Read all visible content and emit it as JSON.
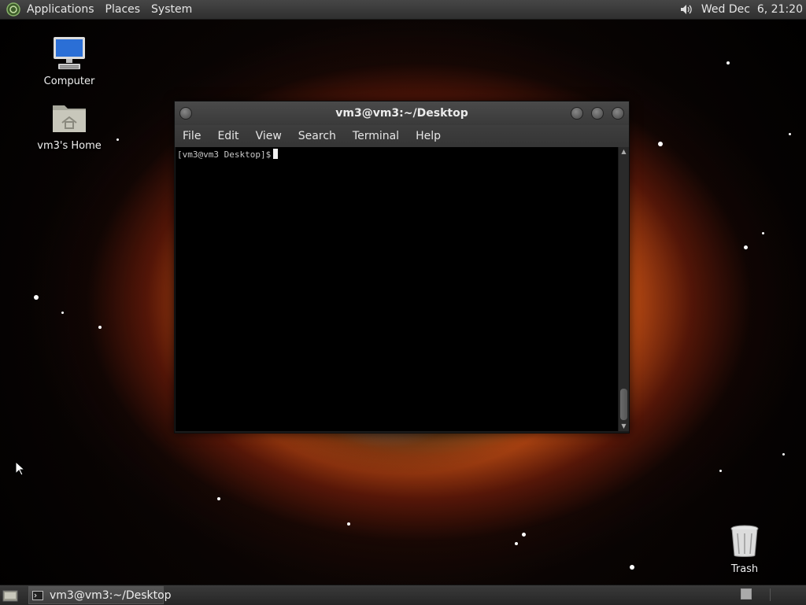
{
  "top_panel": {
    "menus": [
      "Applications",
      "Places",
      "System"
    ],
    "clock": "Wed Dec  6, 21:20",
    "icons": {
      "logo": "distro-logo-icon",
      "volume": "volume-icon"
    }
  },
  "desktop": {
    "icons": [
      {
        "label": "Computer",
        "icon": "computer-icon"
      },
      {
        "label": "vm3's Home",
        "icon": "home-folder-icon"
      },
      {
        "label": "Trash",
        "icon": "trash-icon"
      }
    ]
  },
  "terminal": {
    "title": "vm3@vm3:~/Desktop",
    "menu": [
      "File",
      "Edit",
      "View",
      "Search",
      "Terminal",
      "Help"
    ],
    "prompt": "[vm3@vm3 Desktop]$"
  },
  "bottom_panel": {
    "task_label": "vm3@vm3:~/Desktop",
    "icons": {
      "show_desktop": "show-desktop-icon",
      "terminal": "terminal-icon"
    }
  },
  "colors": {
    "panel": "#3a3a3a",
    "terminal_bg": "#000000",
    "text": "#e6e6e6"
  }
}
